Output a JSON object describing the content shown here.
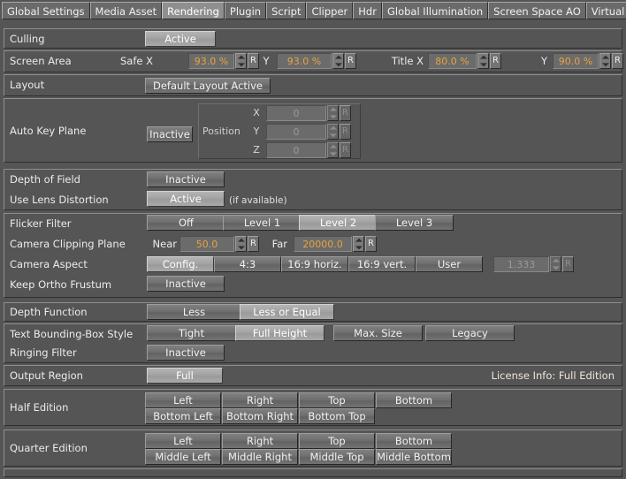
{
  "tabs": [
    {
      "label": "Global Settings",
      "selected": false
    },
    {
      "label": "Media Asset",
      "selected": false
    },
    {
      "label": "Rendering",
      "selected": true
    },
    {
      "label": "Plugin",
      "selected": false
    },
    {
      "label": "Script",
      "selected": false
    },
    {
      "label": "Clipper",
      "selected": false
    },
    {
      "label": "Hdr",
      "selected": false
    },
    {
      "label": "Global Illumination",
      "selected": false
    },
    {
      "label": "Screen Space AO",
      "selected": false
    },
    {
      "label": "Virtual Studio",
      "selected": false
    }
  ],
  "culling": {
    "label": "Culling",
    "toggle": "Active"
  },
  "screen_area": {
    "label": "Screen Area",
    "safe_x_label": "Safe X",
    "safe_x_value": "93.0 %",
    "safe_y_label": "Y",
    "safe_y_value": "93.0 %",
    "title_x_label": "Title X",
    "title_x_value": "80.0 %",
    "title_y_label": "Y",
    "title_y_value": "90.0 %",
    "reset_label": "R"
  },
  "layout": {
    "label": "Layout",
    "button": "Default Layout Active"
  },
  "auto_key_plane": {
    "label": "Auto Key Plane",
    "toggle": "Inactive",
    "position_label": "Position",
    "axes": [
      {
        "axis": "X",
        "value": "0"
      },
      {
        "axis": "Y",
        "value": "0"
      },
      {
        "axis": "Z",
        "value": "0"
      }
    ],
    "reset_label": "R"
  },
  "depth_of_field": {
    "label": "Depth of Field",
    "toggle": "Inactive"
  },
  "lens_distortion": {
    "label": "Use Lens Distortion",
    "toggle": "Active",
    "note": "(if available)"
  },
  "flicker_filter": {
    "label": "Flicker Filter",
    "options": [
      {
        "label": "Off",
        "selected": false
      },
      {
        "label": "Level 1",
        "selected": false
      },
      {
        "label": "Level 2",
        "selected": true
      },
      {
        "label": "Level 3",
        "selected": false
      }
    ]
  },
  "camera_clipping": {
    "label": "Camera Clipping Plane",
    "near_label": "Near",
    "near_value": "50.0",
    "far_label": "Far",
    "far_value": "20000.0",
    "reset_label": "R"
  },
  "camera_aspect": {
    "label": "Camera Aspect",
    "options": [
      {
        "label": "Config.",
        "selected": true
      },
      {
        "label": "4:3",
        "selected": false
      },
      {
        "label": "16:9 horiz.",
        "selected": false
      },
      {
        "label": "16:9 vert.",
        "selected": false
      },
      {
        "label": "User",
        "selected": false
      }
    ],
    "user_value": "1.333",
    "reset_label": "R"
  },
  "keep_ortho_frustum": {
    "label": "Keep Ortho Frustum",
    "toggle": "Inactive"
  },
  "depth_function": {
    "label": "Depth Function",
    "options": [
      {
        "label": "Less",
        "selected": false
      },
      {
        "label": "Less or Equal",
        "selected": true
      }
    ]
  },
  "text_bbox_style": {
    "label": "Text Bounding-Box Style",
    "options": [
      {
        "label": "Tight",
        "selected": false
      },
      {
        "label": "Full Height",
        "selected": true
      },
      {
        "label": "Max. Size",
        "selected": false
      },
      {
        "label": "Legacy",
        "selected": false
      }
    ]
  },
  "ringing_filter": {
    "label": "Ringing Filter",
    "toggle": "Inactive"
  },
  "output_region": {
    "label": "Output Region",
    "button": "Full",
    "license_info": "License Info: Full Edition"
  },
  "half_edition": {
    "label": "Half Edition",
    "row1": [
      "Left",
      "Right",
      "Top",
      "Bottom"
    ],
    "row2": [
      "Bottom Left",
      "Bottom Right",
      "Bottom Top"
    ]
  },
  "quarter_edition": {
    "label": "Quarter Edition",
    "row1": [
      "Left",
      "Right",
      "Top",
      "Bottom"
    ],
    "row2": [
      "Middle Left",
      "Middle Right",
      "Middle Top",
      "Middle Bottom"
    ]
  }
}
